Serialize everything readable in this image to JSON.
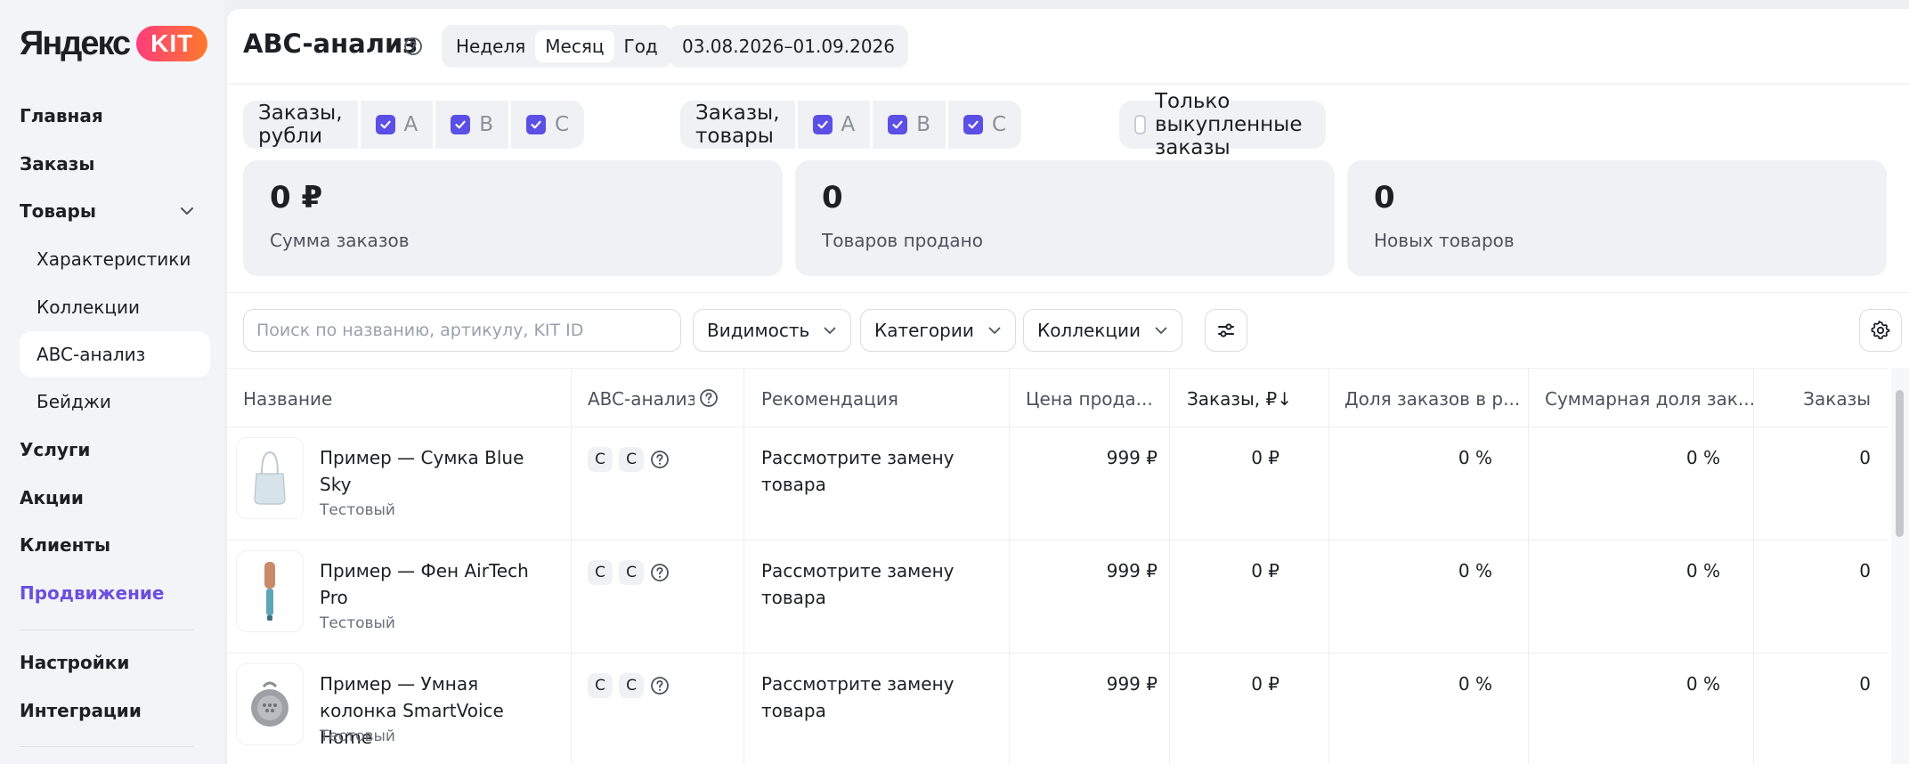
{
  "brand": {
    "logo_text": "Яндекс",
    "logo_badge": "KIT"
  },
  "sidebar": {
    "items": [
      {
        "label": "Главная"
      },
      {
        "label": "Заказы"
      },
      {
        "label": "Товары"
      },
      {
        "label": "Характеристики"
      },
      {
        "label": "Коллекции"
      },
      {
        "label": "ABC-анализ"
      },
      {
        "label": "Бейджи"
      },
      {
        "label": "Услуги"
      },
      {
        "label": "Акции"
      },
      {
        "label": "Клиенты"
      },
      {
        "label": "Продвижение"
      },
      {
        "label": "Настройки"
      },
      {
        "label": "Интеграции"
      }
    ],
    "active_item": "ABC-анализ",
    "accent_color": "#6b4fe0"
  },
  "header": {
    "title": "ABC-анализ",
    "period_options": [
      "Неделя",
      "Месяц",
      "Год"
    ],
    "period_selected": "Месяц",
    "date_range": "03.08.2026–01.09.2026"
  },
  "filters": {
    "rubles": {
      "label": "Заказы, рубли",
      "options": [
        "A",
        "B",
        "C"
      ]
    },
    "goods": {
      "label": "Заказы, товары",
      "options": [
        "A",
        "B",
        "C"
      ]
    },
    "bought_only": {
      "label": "Только выкупленные заказы",
      "checked": false
    },
    "checkbox_color": "#5b4fe6"
  },
  "stats": [
    {
      "value": "0 ₽",
      "label": "Сумма заказов"
    },
    {
      "value": "0",
      "label": "Товаров продано"
    },
    {
      "value": "0",
      "label": "Новых товаров"
    }
  ],
  "toolbar": {
    "search_placeholder": "Поиск по названию, артикулу, KIT ID",
    "visibility": "Видимость",
    "categories": "Категории",
    "collections": "Коллекции"
  },
  "table": {
    "columns": [
      "Название",
      "ABC-анализ",
      "Рекомендация",
      "Цена прода...",
      "Заказы, ₽↓",
      "Доля заказов в р...",
      "Суммарная доля зак...",
      "Заказы"
    ],
    "rows": [
      {
        "name": "Пример — Сумка Blue Sky",
        "tag": "Тестовый",
        "abc": [
          "C",
          "C"
        ],
        "recommendation": "Рассмотрите замену товара",
        "price": "999 ₽",
        "orders_rub": "0 ₽",
        "share": "0 %",
        "cum_share": "0 %",
        "orders": "0",
        "thumb": "bag-image"
      },
      {
        "name": "Пример — Фен AirTech Pro",
        "tag": "Тестовый",
        "abc": [
          "C",
          "C"
        ],
        "recommendation": "Рассмотрите замену товара",
        "price": "999 ₽",
        "orders_rub": "0 ₽",
        "share": "0 %",
        "cum_share": "0 %",
        "orders": "0",
        "thumb": "hairdryer-image"
      },
      {
        "name": "Пример — Умная колонка SmartVoice Home",
        "tag": "Тестовый",
        "abc": [
          "C",
          "C"
        ],
        "recommendation": "Рассмотрите замену товара",
        "price": "999 ₽",
        "orders_rub": "0 ₽",
        "share": "0 %",
        "cum_share": "0 %",
        "orders": "0",
        "thumb": "speaker-image"
      }
    ]
  }
}
